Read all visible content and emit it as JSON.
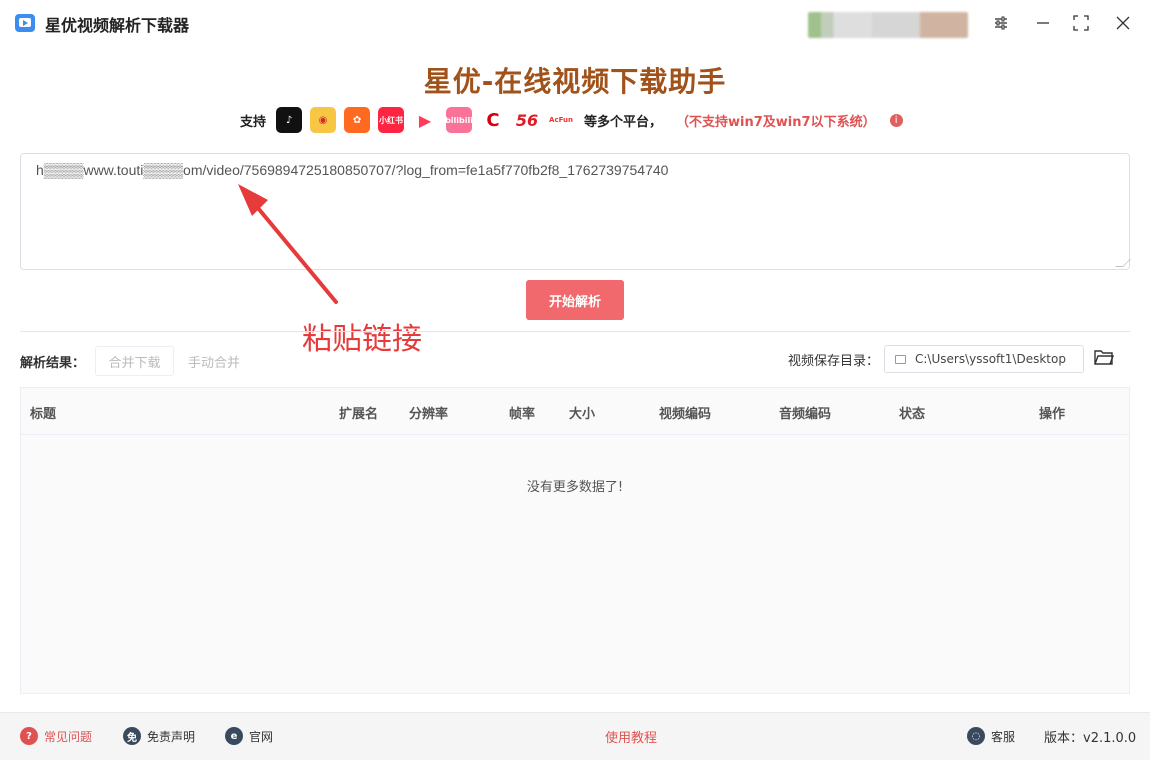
{
  "window": {
    "title": "星优视频解析下载器",
    "icons": {
      "app": "app-logo-icon",
      "settings": "sliders-icon",
      "minimize": "minimize-icon",
      "maximize": "maximize-icon",
      "close": "close-icon"
    }
  },
  "header": {
    "title": "星优-在线视频下载助手",
    "support_label": "支持",
    "platforms": [
      {
        "name": "douyin-icon",
        "glyph": "♪"
      },
      {
        "name": "weibo-icon",
        "glyph": "◉"
      },
      {
        "name": "kuaishou-icon",
        "glyph": "✿"
      },
      {
        "name": "xiaohongshu-icon",
        "glyph": "小红书"
      },
      {
        "name": "xigua-icon",
        "glyph": "▶"
      },
      {
        "name": "bilibili-icon",
        "glyph": "bilibili"
      },
      {
        "name": "cctv-icon",
        "glyph": "C"
      },
      {
        "name": "56-icon",
        "glyph": "56"
      },
      {
        "name": "acfun-icon",
        "glyph": "AcFun"
      }
    ],
    "platforms_suffix": "等多个平台，",
    "warning": "（不支持win7及win7以下系统）"
  },
  "url_input": {
    "value": "h▒▒▒▒www.touti▒▒▒▒om/video/7569894725180850707/?log_from=fe1a5f770fb2f8_1762739754740"
  },
  "parse_button": "开始解析",
  "annotation": {
    "text": "粘贴链接",
    "color": "#e53b3b"
  },
  "results": {
    "label": "解析结果：",
    "merge_download": "合并下载",
    "manual_merge": "手动合并",
    "save_dir_label": "视频保存目录：",
    "save_dir_value": "C:\\Users\\yssoft1\\Desktop",
    "columns": [
      "标题",
      "扩展名",
      "分辨率",
      "帧率",
      "大小",
      "视频编码",
      "音频编码",
      "状态",
      "操作"
    ],
    "empty_text": "没有更多数据了!"
  },
  "footer": {
    "faq": "常见问题",
    "disclaimer": "免责声明",
    "website": "官网",
    "tutorial": "使用教程",
    "service": "客服",
    "version": "版本：v2.1.0.0"
  },
  "colors": {
    "accent": "#f1696c",
    "title": "#a0521a",
    "warning": "#e05252"
  }
}
